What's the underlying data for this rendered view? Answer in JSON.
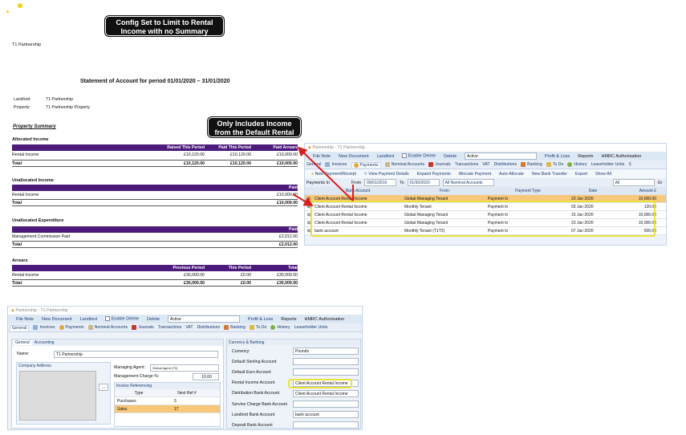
{
  "callouts": {
    "top": "Config Set to Limit to Rental Income with no Summary",
    "middle": "Only Includes Income from the Default Rental Account"
  },
  "report": {
    "company": "T1 Partnership",
    "title": "Statement of Account for period 01/01/2020 – 31/01/2020",
    "landlord_label": "Landlord:",
    "landlord_value": "T1 Partnership",
    "property_label": "Property:",
    "property_value": "T1 Partnership Property",
    "summary_heading": "Property Summary",
    "allocated_income": {
      "title": "Allocated Income",
      "columns": [
        "Raised This Period",
        "Paid This Period",
        "Paid Arrears"
      ],
      "rows": [
        {
          "label": "Rental Income",
          "v": [
            "£10,120.00",
            "£10,120.00",
            "£10,000.00"
          ]
        }
      ],
      "total": {
        "label": "Total",
        "v": [
          "£10,120.00",
          "£10,120.00",
          "£10,000.00"
        ]
      }
    },
    "unallocated_income": {
      "title": "Unallocated Income",
      "column": "Paid",
      "row_label": "Rental Income",
      "row_value": "£10,000.00",
      "total_label": "Total",
      "total_value": "£10,000.00"
    },
    "unallocated_expenditure": {
      "title": "Unallocated Expenditure",
      "column": "Paid",
      "row_label": "Management Commission Paid",
      "row_value": "£2,012.00",
      "total_label": "Total",
      "total_value": "£2,012.00"
    },
    "arrears": {
      "title": "Arrears",
      "columns": [
        "Previous Period",
        "This Period",
        "Total"
      ],
      "row": {
        "label": "Rental Income",
        "v": [
          "£30,000.00",
          "£0.00",
          "£30,000.00"
        ]
      },
      "total": {
        "label": "Total",
        "v": [
          "£30,000.00",
          "£0.00",
          "£30,000.00"
        ]
      }
    }
  },
  "payments_window": {
    "title": "Partnership - T1 Partnership",
    "menu": [
      "File Note",
      "New Document",
      "Landlord",
      "Enable Delete",
      "Delete",
      "Active",
      "Profit & Loss",
      "Reports",
      "HMRC Authorisation"
    ],
    "tabs": [
      "General",
      "Invoices",
      "Payments",
      "Nominal Accounts",
      "Journals",
      "Transactions",
      "VAT",
      "Distributions",
      "Banking",
      "To Do",
      "History",
      "Leaseholder Units",
      "S"
    ],
    "toolbar": [
      "New Payment/Receipt",
      "View Payment Details",
      "Expand Payments",
      "Allocate Payment",
      "Auto-Allocate",
      "New Bank Transfer",
      "Export",
      "Show All"
    ],
    "filter": {
      "type": "Payments In",
      "from_label": "From",
      "from": "09/01/2019",
      "to_label": "To",
      "to": "01/30/2020",
      "nominal": "All Nominal Accounts",
      "all": "All",
      "gr": "Gr"
    },
    "columns": [
      "Bank Account",
      "From",
      "Payment Type",
      "Date",
      "Amount £"
    ],
    "rows": [
      [
        "Client Account Rental Income",
        "Global Managing Tenant",
        "Payment In",
        "23 Jan 2020",
        "10,000.00"
      ],
      [
        "Client Account Rental Income",
        "Monthly Tenant",
        "Payment In",
        "03 Jan 2020",
        "120.00"
      ],
      [
        "Client Account Rental Income",
        "Global Managing Tenant",
        "Payment In",
        "15 Jan 2020",
        "10,000.00"
      ],
      [
        "Client Account Rental Income",
        "Global Managing Tenant",
        "Payment In",
        "23 Jan 2020",
        "10,000.00"
      ],
      [
        "bank account",
        "Monthly Tenant (T1T2)",
        "Payment In",
        "07 Jan 2020",
        "500.00"
      ]
    ]
  },
  "general_window": {
    "title": "Partnership - T1 Partnership",
    "menu": [
      "File Note",
      "New Document",
      "Landlord",
      "Enable Delete",
      "Delete",
      "Active",
      "Profit & Loss",
      "Reports",
      "HMRC Authorisation"
    ],
    "tabs": [
      "General",
      "Invoices",
      "Payments",
      "Nominal Accounts",
      "Journals",
      "Transactions",
      "VAT",
      "Distributions",
      "Banking",
      "To Do",
      "History",
      "Leaseholder Units"
    ],
    "subtabs": [
      "General",
      "Accounting"
    ],
    "name_label": "Name:",
    "name_value": "T1 Partnership",
    "company_address": "Company Address",
    "ellipsis": "...",
    "managing_agent_label": "Managing Agent:",
    "managing_agent_value": "Global Agent (T0)",
    "mgmt_charge_label": "Management Charge %:",
    "mgmt_charge_value": "10.00",
    "invoice_ref_title": "Invoice Referencing",
    "invoice_ref_cols": [
      "Type",
      "Next Ref #"
    ],
    "invoice_ref_rows": [
      [
        "Purchases",
        "5"
      ],
      [
        "Sales",
        "17"
      ]
    ],
    "currency_banking_title": "Currency & Banking",
    "fields": [
      {
        "label": "Currency:",
        "value": "Pounds"
      },
      {
        "label": "Default Sterling Account",
        "value": ""
      },
      {
        "label": "Default Euro Account",
        "value": ""
      },
      {
        "label": "Rental Income Account",
        "value": "Client Account Rental Income"
      },
      {
        "label": "Distribution Bank Account",
        "value": "Client Account Rental Income"
      },
      {
        "label": "Service Charge Bank Account",
        "value": ""
      },
      {
        "label": "Landlord Bank Account",
        "value": "bank account"
      },
      {
        "label": "Deposit Bank Account",
        "value": ""
      }
    ]
  }
}
